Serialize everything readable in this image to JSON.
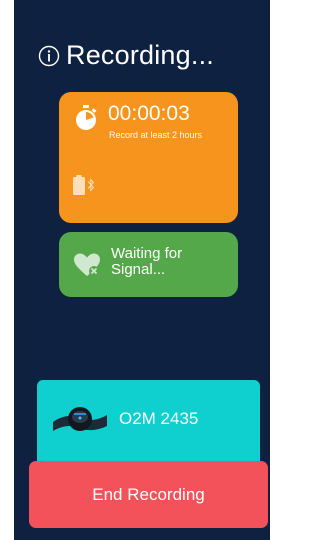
{
  "header": {
    "title": "Recording...",
    "info_icon": "info-icon"
  },
  "timer_card": {
    "elapsed": "00:00:03",
    "hint": "Record at least 2 hours",
    "color": "#f7941d",
    "icons": [
      "stopwatch-icon",
      "battery-icon",
      "bluetooth-icon"
    ]
  },
  "signal_card": {
    "status": "Waiting for\nSignal...",
    "color": "#55a84a",
    "icon": "heart-x-icon"
  },
  "device_card": {
    "name": "O2M 2435",
    "color": "#0fcfcf",
    "icon": "wrist-device-icon"
  },
  "end_button": {
    "label": "End Recording",
    "color": "#f3525a"
  },
  "theme": {
    "background": "#0f2140"
  }
}
